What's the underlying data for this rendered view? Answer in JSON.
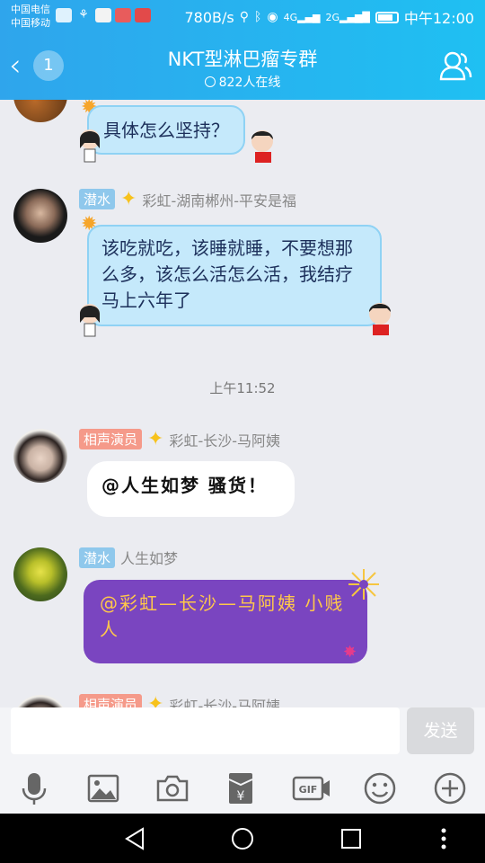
{
  "status_bar": {
    "carrier_1": "中国电信",
    "carrier_2": "中国移动",
    "speed": "780B/s",
    "time": "中午12:00"
  },
  "header": {
    "back_badge": "1",
    "title": "NKT型淋巴瘤专群",
    "online_count": "822人在线"
  },
  "messages": [
    {
      "text": "具体怎么坚持？"
    },
    {
      "tag": "潜水",
      "sender": "彩虹-湖南郴州-平安是福",
      "text": "该吃就吃，该睡就睡，不要想那么多，该怎么活怎么活，我结疗马上六年了"
    },
    {
      "tag": "相声演员",
      "sender": "彩虹-长沙-马阿姨",
      "text": "@人生如梦 骚货！"
    },
    {
      "tag": "潜水",
      "sender": "人生如梦",
      "text": "@彩虹—长沙—马阿姨 小贱人"
    },
    {
      "tag": "相声演员",
      "sender": "彩虹-长沙-马阿姨"
    }
  ],
  "timestamp": "上午11:52",
  "composer": {
    "input_value": "",
    "send_label": "发送"
  },
  "toolbar_icons": [
    "microphone-icon",
    "image-icon",
    "camera-icon",
    "red-packet-icon",
    "gif-icon",
    "emoji-icon",
    "plus-icon"
  ],
  "colors": {
    "header_start": "#2fa5ec",
    "header_end": "#1fc0f2",
    "blue_bubble": "#c5e9fb",
    "purple_bubble": "#7a45c0",
    "purple_text": "#ffc84a"
  }
}
